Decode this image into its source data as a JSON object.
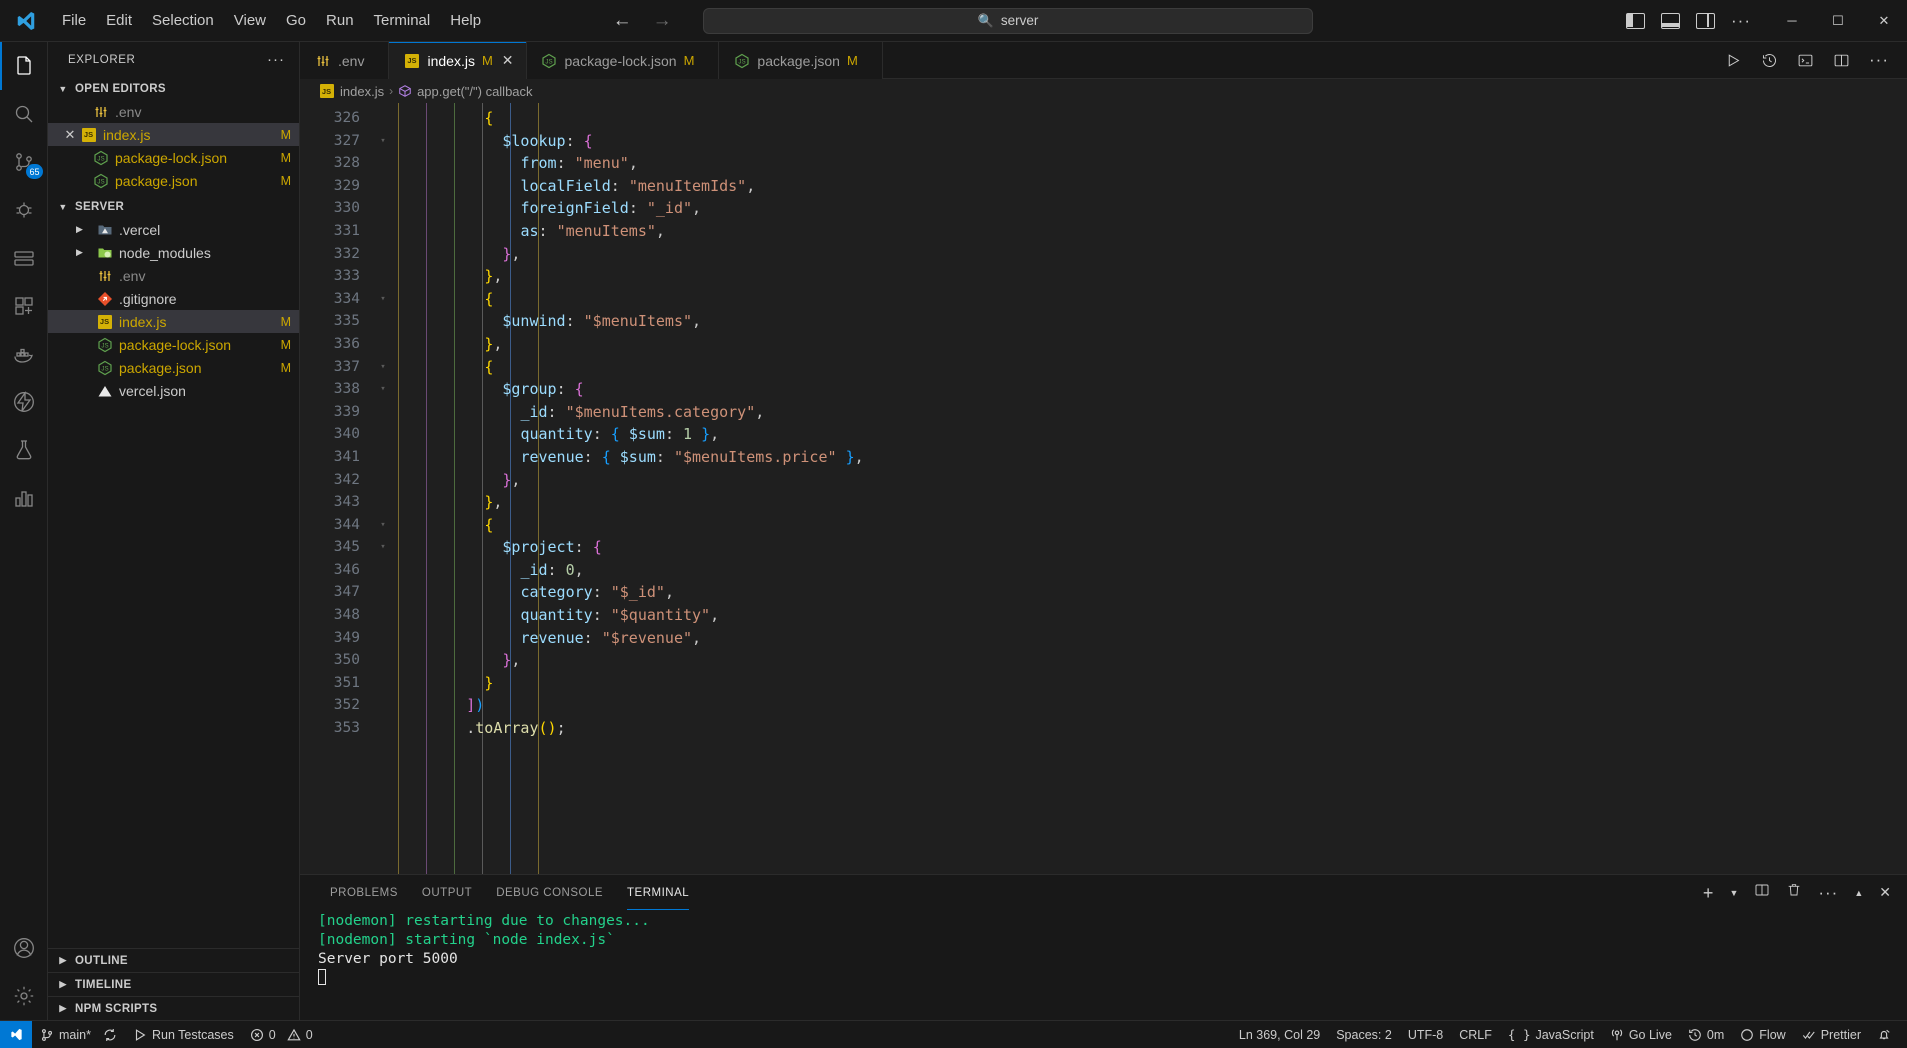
{
  "titlebar": {
    "menu": [
      "File",
      "Edit",
      "Selection",
      "View",
      "Go",
      "Run",
      "Terminal",
      "Help"
    ],
    "search_value": "server",
    "back_arrow": "←",
    "forward_arrow": "→",
    "minimize": "─",
    "maximize": "☐",
    "close": "✕",
    "more": "···"
  },
  "activitybar": {
    "items": [
      {
        "name": "explorer",
        "active": true,
        "badge": ""
      },
      {
        "name": "search",
        "active": false,
        "badge": ""
      },
      {
        "name": "source-control",
        "active": false,
        "badge": "65"
      },
      {
        "name": "run-and-debug",
        "active": false,
        "badge": ""
      },
      {
        "name": "remote-explorer",
        "active": false,
        "badge": ""
      },
      {
        "name": "extensions",
        "active": false,
        "badge": ""
      },
      {
        "name": "docker",
        "active": false,
        "badge": ""
      },
      {
        "name": "thunder-client",
        "active": false,
        "badge": ""
      },
      {
        "name": "testing-beaker",
        "active": false,
        "badge": ""
      },
      {
        "name": "analytics",
        "active": false,
        "badge": ""
      }
    ],
    "bottom": [
      {
        "name": "accounts"
      },
      {
        "name": "settings-gear"
      }
    ]
  },
  "sidebar": {
    "title": "EXPLORER",
    "more_actions": "···",
    "open_editors": {
      "label": "OPEN EDITORS",
      "items": [
        {
          "name": ".env",
          "icon": "env-icon",
          "mark": "",
          "closable": false,
          "selected": false,
          "modified": false
        },
        {
          "name": "index.js",
          "icon": "js-icon",
          "mark": "M",
          "closable": true,
          "selected": true,
          "modified": true
        },
        {
          "name": "package-lock.json",
          "icon": "node-icon",
          "mark": "M",
          "closable": false,
          "selected": false,
          "modified": true
        },
        {
          "name": "package.json",
          "icon": "node-icon",
          "mark": "M",
          "closable": false,
          "selected": false,
          "modified": true
        }
      ]
    },
    "server": {
      "label": "SERVER",
      "items": [
        {
          "name": ".vercel",
          "icon": "folder-vercel-icon",
          "mark": "",
          "expandable": true,
          "selected": false,
          "modified": false
        },
        {
          "name": "node_modules",
          "icon": "folder-node-icon",
          "mark": "",
          "expandable": true,
          "selected": false,
          "modified": false
        },
        {
          "name": ".env",
          "icon": "env-icon",
          "mark": "",
          "expandable": false,
          "selected": false,
          "modified": false
        },
        {
          "name": ".gitignore",
          "icon": "git-icon",
          "mark": "",
          "expandable": false,
          "selected": false,
          "modified": false
        },
        {
          "name": "index.js",
          "icon": "js-icon",
          "mark": "M",
          "expandable": false,
          "selected": true,
          "modified": true
        },
        {
          "name": "package-lock.json",
          "icon": "node-icon",
          "mark": "M",
          "expandable": false,
          "selected": false,
          "modified": true
        },
        {
          "name": "package.json",
          "icon": "node-icon",
          "mark": "M",
          "expandable": false,
          "selected": false,
          "modified": true
        },
        {
          "name": "vercel.json",
          "icon": "vercel-icon",
          "mark": "",
          "expandable": false,
          "selected": false,
          "modified": false
        }
      ]
    },
    "bottom_sections": [
      "OUTLINE",
      "TIMELINE",
      "NPM SCRIPTS"
    ]
  },
  "tabs": [
    {
      "label": ".env",
      "icon": "env-icon",
      "mark": "",
      "active": false,
      "closable": false
    },
    {
      "label": "index.js",
      "icon": "js-icon",
      "mark": "M",
      "active": true,
      "closable": true
    },
    {
      "label": "package-lock.json",
      "icon": "node-icon",
      "mark": "M",
      "active": false,
      "closable": false
    },
    {
      "label": "package.json",
      "icon": "node-icon",
      "mark": "M",
      "active": false,
      "closable": false
    }
  ],
  "tab_actions": [
    "run-button",
    "history-icon",
    "split-terminal-icon",
    "split-editor-icon",
    "more-actions-icon"
  ],
  "breadcrumbs": {
    "file": "index.js",
    "separator": "›",
    "symbol": "app.get(\"/\") callback"
  },
  "editor": {
    "first_line": 326,
    "lines": [
      {
        "n": 326,
        "fold": "",
        "tokens": [
          {
            "t": "          ",
            "c": "t-plain"
          },
          {
            "t": "{",
            "c": "t-b1"
          }
        ]
      },
      {
        "n": 327,
        "fold": "v",
        "tokens": [
          {
            "t": "            ",
            "c": "t-plain"
          },
          {
            "t": "$lookup",
            "c": "t-key"
          },
          {
            "t": ": ",
            "c": "t-punct"
          },
          {
            "t": "{",
            "c": "t-b2"
          }
        ]
      },
      {
        "n": 328,
        "fold": "",
        "tokens": [
          {
            "t": "              ",
            "c": "t-plain"
          },
          {
            "t": "from",
            "c": "t-key"
          },
          {
            "t": ": ",
            "c": "t-punct"
          },
          {
            "t": "\"menu\"",
            "c": "t-str"
          },
          {
            "t": ",",
            "c": "t-punct"
          }
        ]
      },
      {
        "n": 329,
        "fold": "",
        "tokens": [
          {
            "t": "              ",
            "c": "t-plain"
          },
          {
            "t": "localField",
            "c": "t-key"
          },
          {
            "t": ": ",
            "c": "t-punct"
          },
          {
            "t": "\"menuItemIds\"",
            "c": "t-str"
          },
          {
            "t": ",",
            "c": "t-punct"
          }
        ]
      },
      {
        "n": 330,
        "fold": "",
        "tokens": [
          {
            "t": "              ",
            "c": "t-plain"
          },
          {
            "t": "foreignField",
            "c": "t-key"
          },
          {
            "t": ": ",
            "c": "t-punct"
          },
          {
            "t": "\"_id\"",
            "c": "t-str"
          },
          {
            "t": ",",
            "c": "t-punct"
          }
        ]
      },
      {
        "n": 331,
        "fold": "",
        "tokens": [
          {
            "t": "              ",
            "c": "t-plain"
          },
          {
            "t": "as",
            "c": "t-key"
          },
          {
            "t": ": ",
            "c": "t-punct"
          },
          {
            "t": "\"menuItems\"",
            "c": "t-str"
          },
          {
            "t": ",",
            "c": "t-punct"
          }
        ]
      },
      {
        "n": 332,
        "fold": "",
        "tokens": [
          {
            "t": "            ",
            "c": "t-plain"
          },
          {
            "t": "}",
            "c": "t-b2"
          },
          {
            "t": ",",
            "c": "t-punct"
          }
        ]
      },
      {
        "n": 333,
        "fold": "",
        "tokens": [
          {
            "t": "          ",
            "c": "t-plain"
          },
          {
            "t": "}",
            "c": "t-b1"
          },
          {
            "t": ",",
            "c": "t-punct"
          }
        ]
      },
      {
        "n": 334,
        "fold": "v",
        "tokens": [
          {
            "t": "          ",
            "c": "t-plain"
          },
          {
            "t": "{",
            "c": "t-b1"
          }
        ]
      },
      {
        "n": 335,
        "fold": "",
        "tokens": [
          {
            "t": "            ",
            "c": "t-plain"
          },
          {
            "t": "$unwind",
            "c": "t-key"
          },
          {
            "t": ": ",
            "c": "t-punct"
          },
          {
            "t": "\"$menuItems\"",
            "c": "t-str"
          },
          {
            "t": ",",
            "c": "t-punct"
          }
        ]
      },
      {
        "n": 336,
        "fold": "",
        "tokens": [
          {
            "t": "          ",
            "c": "t-plain"
          },
          {
            "t": "}",
            "c": "t-b1"
          },
          {
            "t": ",",
            "c": "t-punct"
          }
        ]
      },
      {
        "n": 337,
        "fold": "v",
        "tokens": [
          {
            "t": "          ",
            "c": "t-plain"
          },
          {
            "t": "{",
            "c": "t-b1"
          }
        ]
      },
      {
        "n": 338,
        "fold": "v",
        "tokens": [
          {
            "t": "            ",
            "c": "t-plain"
          },
          {
            "t": "$group",
            "c": "t-key"
          },
          {
            "t": ": ",
            "c": "t-punct"
          },
          {
            "t": "{",
            "c": "t-b2"
          }
        ]
      },
      {
        "n": 339,
        "fold": "",
        "tokens": [
          {
            "t": "              ",
            "c": "t-plain"
          },
          {
            "t": "_id",
            "c": "t-key"
          },
          {
            "t": ": ",
            "c": "t-punct"
          },
          {
            "t": "\"$menuItems.category\"",
            "c": "t-str"
          },
          {
            "t": ",",
            "c": "t-punct"
          }
        ]
      },
      {
        "n": 340,
        "fold": "",
        "tokens": [
          {
            "t": "              ",
            "c": "t-plain"
          },
          {
            "t": "quantity",
            "c": "t-key"
          },
          {
            "t": ": ",
            "c": "t-punct"
          },
          {
            "t": "{",
            "c": "t-b3"
          },
          {
            "t": " ",
            "c": "t-plain"
          },
          {
            "t": "$sum",
            "c": "t-key"
          },
          {
            "t": ": ",
            "c": "t-punct"
          },
          {
            "t": "1",
            "c": "t-num"
          },
          {
            "t": " ",
            "c": "t-plain"
          },
          {
            "t": "}",
            "c": "t-b3"
          },
          {
            "t": ",",
            "c": "t-punct"
          }
        ]
      },
      {
        "n": 341,
        "fold": "",
        "tokens": [
          {
            "t": "              ",
            "c": "t-plain"
          },
          {
            "t": "revenue",
            "c": "t-key"
          },
          {
            "t": ": ",
            "c": "t-punct"
          },
          {
            "t": "{",
            "c": "t-b3"
          },
          {
            "t": " ",
            "c": "t-plain"
          },
          {
            "t": "$sum",
            "c": "t-key"
          },
          {
            "t": ": ",
            "c": "t-punct"
          },
          {
            "t": "\"$menuItems.price\"",
            "c": "t-str"
          },
          {
            "t": " ",
            "c": "t-plain"
          },
          {
            "t": "}",
            "c": "t-b3"
          },
          {
            "t": ",",
            "c": "t-punct"
          }
        ]
      },
      {
        "n": 342,
        "fold": "",
        "tokens": [
          {
            "t": "            ",
            "c": "t-plain"
          },
          {
            "t": "}",
            "c": "t-b2"
          },
          {
            "t": ",",
            "c": "t-punct"
          }
        ]
      },
      {
        "n": 343,
        "fold": "",
        "tokens": [
          {
            "t": "          ",
            "c": "t-plain"
          },
          {
            "t": "}",
            "c": "t-b1"
          },
          {
            "t": ",",
            "c": "t-punct"
          }
        ]
      },
      {
        "n": 344,
        "fold": "v",
        "tokens": [
          {
            "t": "          ",
            "c": "t-plain"
          },
          {
            "t": "{",
            "c": "t-b1"
          }
        ]
      },
      {
        "n": 345,
        "fold": "v",
        "tokens": [
          {
            "t": "            ",
            "c": "t-plain"
          },
          {
            "t": "$project",
            "c": "t-key"
          },
          {
            "t": ": ",
            "c": "t-punct"
          },
          {
            "t": "{",
            "c": "t-b2"
          }
        ]
      },
      {
        "n": 346,
        "fold": "",
        "tokens": [
          {
            "t": "              ",
            "c": "t-plain"
          },
          {
            "t": "_id",
            "c": "t-key"
          },
          {
            "t": ": ",
            "c": "t-punct"
          },
          {
            "t": "0",
            "c": "t-num"
          },
          {
            "t": ",",
            "c": "t-punct"
          }
        ]
      },
      {
        "n": 347,
        "fold": "",
        "tokens": [
          {
            "t": "              ",
            "c": "t-plain"
          },
          {
            "t": "category",
            "c": "t-key"
          },
          {
            "t": ": ",
            "c": "t-punct"
          },
          {
            "t": "\"$_id\"",
            "c": "t-str"
          },
          {
            "t": ",",
            "c": "t-punct"
          }
        ]
      },
      {
        "n": 348,
        "fold": "",
        "tokens": [
          {
            "t": "              ",
            "c": "t-plain"
          },
          {
            "t": "quantity",
            "c": "t-key"
          },
          {
            "t": ": ",
            "c": "t-punct"
          },
          {
            "t": "\"$quantity\"",
            "c": "t-str"
          },
          {
            "t": ",",
            "c": "t-punct"
          }
        ]
      },
      {
        "n": 349,
        "fold": "",
        "tokens": [
          {
            "t": "              ",
            "c": "t-plain"
          },
          {
            "t": "revenue",
            "c": "t-key"
          },
          {
            "t": ": ",
            "c": "t-punct"
          },
          {
            "t": "\"$revenue\"",
            "c": "t-str"
          },
          {
            "t": ",",
            "c": "t-punct"
          }
        ]
      },
      {
        "n": 350,
        "fold": "",
        "tokens": [
          {
            "t": "            ",
            "c": "t-plain"
          },
          {
            "t": "}",
            "c": "t-b2"
          },
          {
            "t": ",",
            "c": "t-punct"
          }
        ]
      },
      {
        "n": 351,
        "fold": "",
        "tokens": [
          {
            "t": "          ",
            "c": "t-plain"
          },
          {
            "t": "}",
            "c": "t-b1"
          }
        ]
      },
      {
        "n": 352,
        "fold": "",
        "tokens": [
          {
            "t": "        ",
            "c": "t-plain"
          },
          {
            "t": "]",
            "c": "t-b2"
          },
          {
            "t": ")",
            "c": "t-b3"
          }
        ]
      },
      {
        "n": 353,
        "fold": "",
        "tokens": [
          {
            "t": "        ",
            "c": "t-plain"
          },
          {
            "t": ".",
            "c": "t-punct"
          },
          {
            "t": "toArray",
            "c": "t-fn"
          },
          {
            "t": "()",
            "c": "t-b1"
          },
          {
            "t": ";",
            "c": "t-punct"
          }
        ]
      }
    ]
  },
  "panel": {
    "tabs": [
      "PROBLEMS",
      "OUTPUT",
      "DEBUG CONSOLE",
      "TERMINAL"
    ],
    "active_tab": "TERMINAL",
    "actions": [
      "new-terminal-plus",
      "chevron-down-icon",
      "split-terminal-icon",
      "kill-terminal-icon",
      "more-actions-icon",
      "chevron-up-icon",
      "close-panel-icon"
    ],
    "terminal_lines": [
      {
        "text": "[nodemon] restarting due to changes...",
        "color": "green"
      },
      {
        "text": "[nodemon] starting `node index.js`",
        "color": "green"
      },
      {
        "text": "Server port 5000",
        "color": "white"
      }
    ]
  },
  "statusbar": {
    "left": [
      {
        "name": "remote-indicator",
        "label": ""
      },
      {
        "name": "branch",
        "label": "main*"
      },
      {
        "name": "sync",
        "label": ""
      },
      {
        "name": "run-testcases",
        "label": "Run Testcases"
      },
      {
        "name": "errors",
        "label": "0"
      },
      {
        "name": "warnings",
        "label": "0"
      }
    ],
    "right": [
      {
        "name": "cursor-position",
        "label": "Ln 369, Col 29"
      },
      {
        "name": "indentation",
        "label": "Spaces: 2"
      },
      {
        "name": "encoding",
        "label": "UTF-8"
      },
      {
        "name": "eol",
        "label": "CRLF"
      },
      {
        "name": "language-mode",
        "label": "JavaScript"
      },
      {
        "name": "go-live",
        "label": "Go Live"
      },
      {
        "name": "wakatime",
        "label": "0m"
      },
      {
        "name": "flow",
        "label": "Flow"
      },
      {
        "name": "prettier",
        "label": "Prettier"
      },
      {
        "name": "notifications",
        "label": ""
      }
    ]
  },
  "colors": {
    "accent": "#0078d4",
    "modified": "#cca700",
    "terminal_green": "#23d18b",
    "bg": "#1f1f1f",
    "chrome": "#181818"
  }
}
